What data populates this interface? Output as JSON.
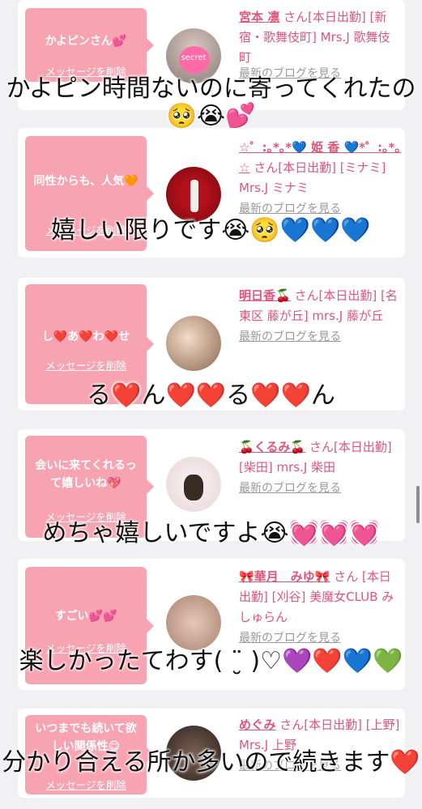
{
  "delete_label": "メッセージを削除",
  "blog_label": "最新のブログを見る",
  "cards": [
    {
      "message": "かよピンさん💕",
      "name": "宮本 凛",
      "rest": "さん[本日出勤] [新宿・歌舞伎町] Mrs.J 歌舞伎町",
      "avatar_text": "secret"
    },
    {
      "message": "同性からも、人気🧡",
      "name": "☆゜:｡*｡*💙 姫 香 💙*゜:｡*｡☆",
      "rest": "さん[本日出勤] [ミナミ] Mrs.J ミナミ"
    },
    {
      "message": "し❤️あ❤️わ❤️せ",
      "name": "明日香🍒",
      "rest": "さん[本日出勤] [名東区 藤が丘] mrs.J 藤が丘"
    },
    {
      "message": "会いに来てくれるって嬉しいね💖",
      "name": "🍒くるみ🍒",
      "rest": "さん[本日出勤] [柴田] mrs.J 柴田"
    },
    {
      "message": "すごい💕💕",
      "name": "🎀華月　みゆ🎀",
      "rest": "さん [本日出勤] [刈谷] 美魔女CLUB みしゅらん"
    },
    {
      "message": "いつまでも続いて欲しい関係性😋",
      "name": "めぐみ",
      "rest": "さん[本日出勤] [上野] Mrs.J 上野"
    }
  ],
  "captions": [
    "かよピン時間ないのに寄ってくれたの🥺😭💕",
    "嬉しい限りです😭🥺💙💙💙",
    "る❤️ん❤️❤️る❤️❤️ん",
    "めちゃ嬉しいですよ😭💓💓💓",
    "楽しかったてわす( ¨̮ )♡💜❤️💙💚",
    "分かり合える所か多いので続きます❤️"
  ]
}
